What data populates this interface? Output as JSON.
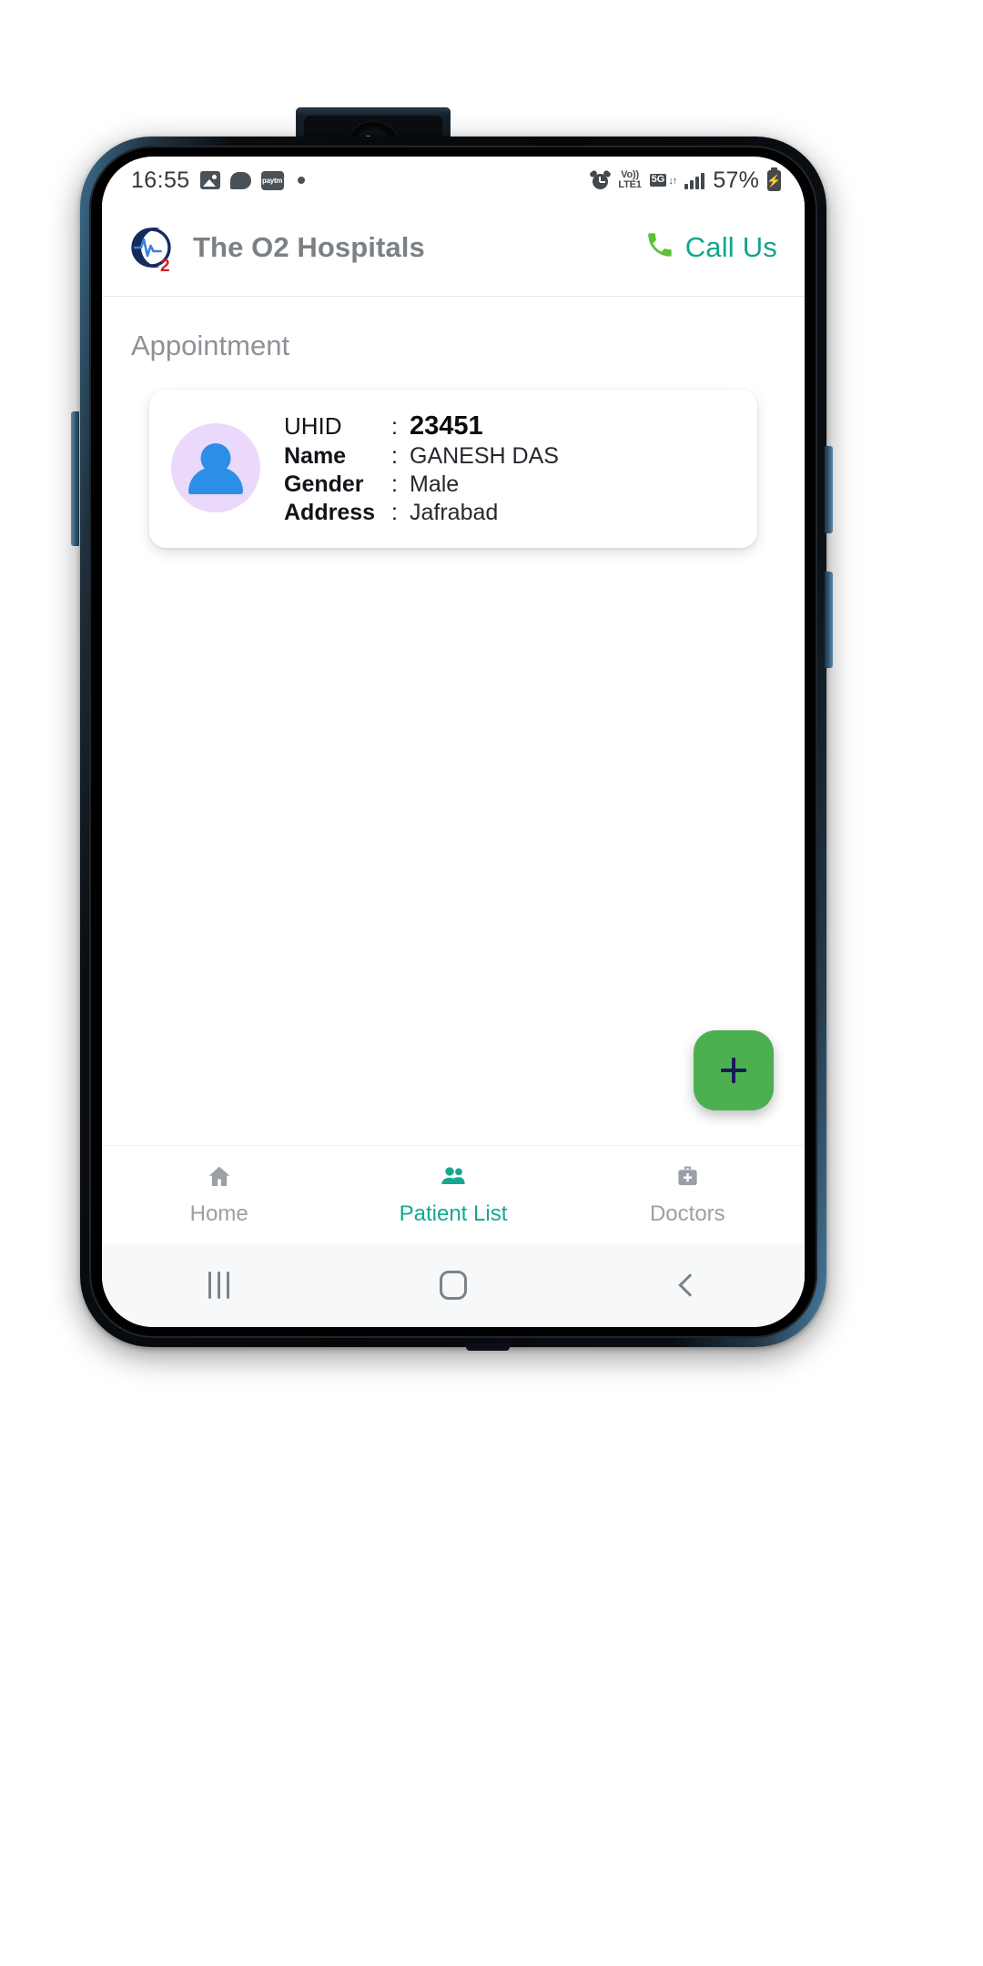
{
  "status_bar": {
    "time": "16:55",
    "left_icons": [
      "image-icon",
      "chat-icon",
      "paytm-icon",
      "dot-icon"
    ],
    "paytm_label": "paytm",
    "alarm_icon": "alarm-icon",
    "volte_line1": "Vo))",
    "volte_line2": "LTE1",
    "network_badge": "5G",
    "data_arrows": "↓↑",
    "signal_icon": "signal-bars-icon",
    "battery_percent": "57%",
    "battery_icon": "battery-charging-icon",
    "battery_bolt": "⚡"
  },
  "header": {
    "logo_name": "o2-hospitals-logo",
    "logo_subscript": "2",
    "title": "The O2 Hospitals",
    "call_us_label": "Call Us",
    "phone_icon": "phone-icon"
  },
  "page": {
    "title": "Appointment"
  },
  "patient_card": {
    "avatar_icon": "person-avatar-icon",
    "rows": [
      {
        "label": "UHID",
        "colon": ":",
        "value": "23451"
      },
      {
        "label": "Name",
        "colon": ":",
        "value": "GANESH DAS"
      },
      {
        "label": "Gender",
        "colon": ":",
        "value": "Male"
      },
      {
        "label": "Address",
        "colon": ":",
        "value": "Jafrabad"
      }
    ]
  },
  "fab": {
    "icon": "plus-icon",
    "label": "+"
  },
  "bottom_nav": {
    "items": [
      {
        "label": "Home",
        "icon": "home-icon",
        "active": false
      },
      {
        "label": "Patient List",
        "icon": "people-icon",
        "active": true
      },
      {
        "label": "Doctors",
        "icon": "medical-bag-icon",
        "active": false
      }
    ]
  },
  "android_nav": {
    "recents": "recents-icon",
    "home": "home-pill-icon",
    "back": "back-icon"
  },
  "colors": {
    "accent_teal": "#13a58c",
    "phone_green": "#5bc236",
    "fab_green": "#4cb050",
    "avatar_bg": "#ead9fb",
    "avatar_fg": "#2b8fe8",
    "logo_navy": "#152b5e",
    "logo_red": "#d22128",
    "muted_text": "#8d9298"
  }
}
